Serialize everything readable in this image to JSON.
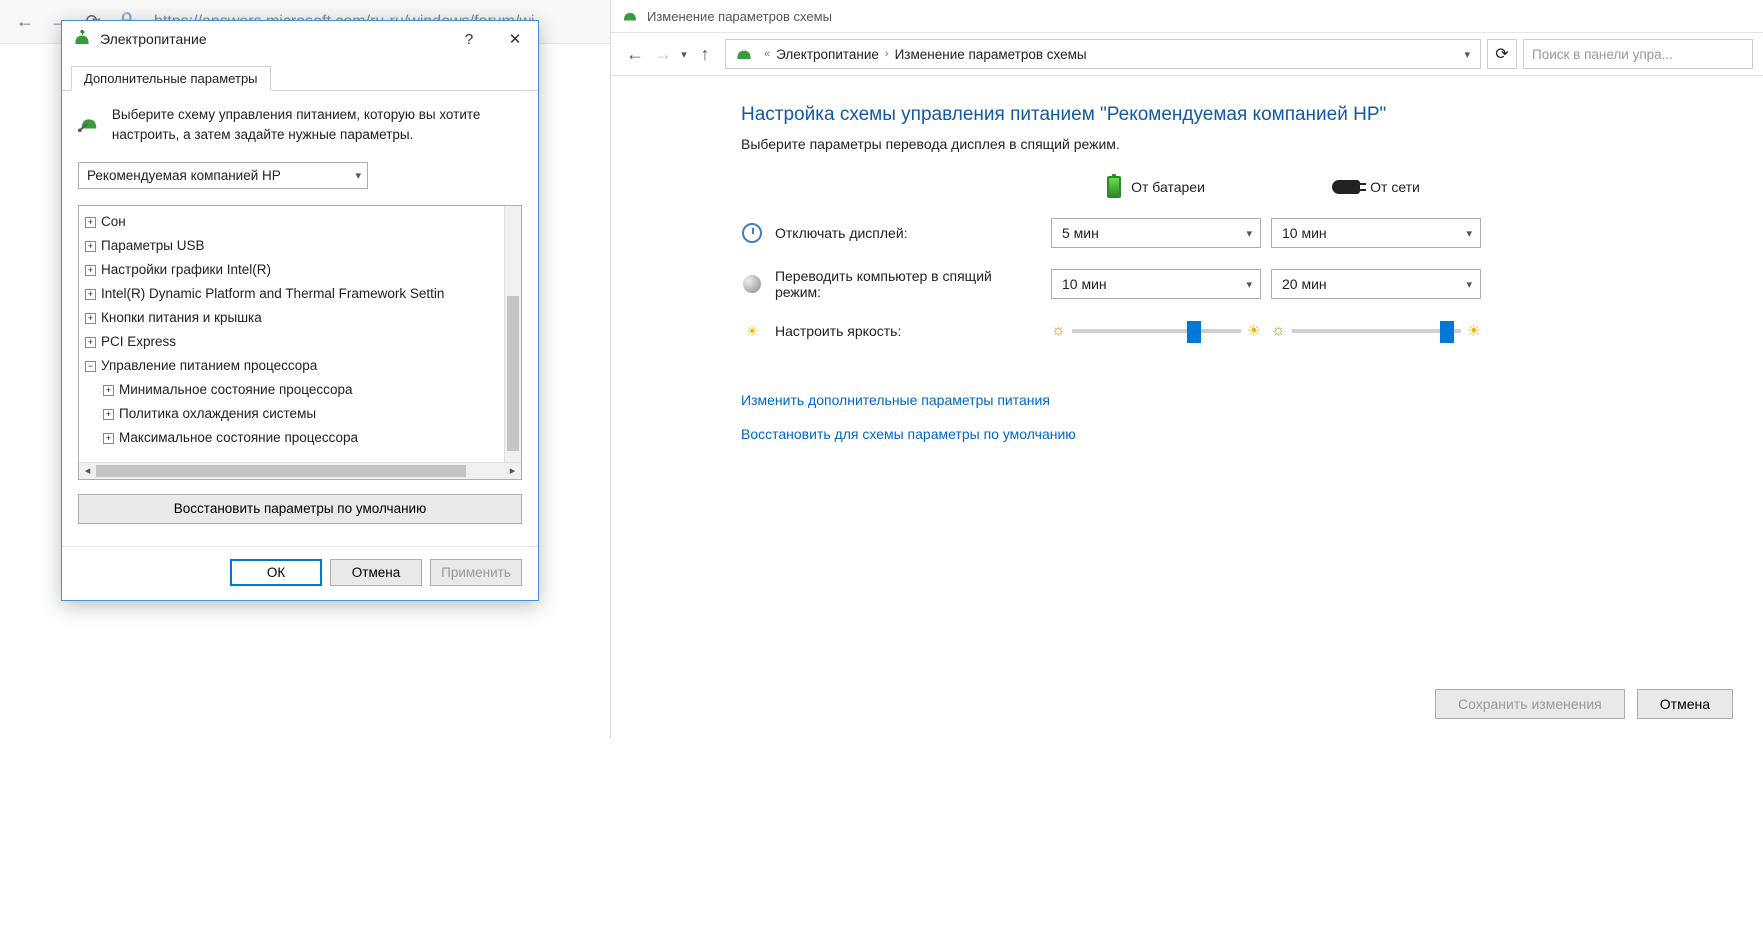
{
  "browser": {
    "url": "https://answers.microsoft.com/ru-ru/windows/forum/wi"
  },
  "dialog": {
    "title": "Электропитание",
    "tab": "Дополнительные параметры",
    "instruction": "Выберите схему управления питанием, которую вы хотите настроить, а затем задайте нужные параметры.",
    "combo": "Рекомендуемая компанией HP",
    "tree": [
      {
        "label": "Сон",
        "lvl": 0,
        "exp": "+"
      },
      {
        "label": "Параметры USB",
        "lvl": 0,
        "exp": "+"
      },
      {
        "label": "Настройки графики Intel(R)",
        "lvl": 0,
        "exp": "+"
      },
      {
        "label": "Intel(R) Dynamic Platform and Thermal Framework Settin",
        "lvl": 0,
        "exp": "+"
      },
      {
        "label": "Кнопки питания и крышка",
        "lvl": 0,
        "exp": "+"
      },
      {
        "label": "PCI Express",
        "lvl": 0,
        "exp": "+"
      },
      {
        "label": "Управление питанием процессора",
        "lvl": 0,
        "exp": "−"
      },
      {
        "label": "Минимальное состояние процессора",
        "lvl": 1,
        "exp": "+"
      },
      {
        "label": "Политика охлаждения системы",
        "lvl": 1,
        "exp": "+"
      },
      {
        "label": "Максимальное состояние процессора",
        "lvl": 1,
        "exp": "+"
      }
    ],
    "restore_btn": "Восстановить параметры по умолчанию",
    "ok": "ОК",
    "cancel": "Отмена",
    "apply": "Применить"
  },
  "panel": {
    "window_title": "Изменение параметров схемы",
    "crumb1": "Электропитание",
    "crumb2": "Изменение параметров схемы",
    "search_placeholder": "Поиск в панели упра...",
    "heading": "Настройка схемы управления питанием \"Рекомендуемая компанией HP\"",
    "sub": "Выберите параметры перевода дисплея в спящий режим.",
    "col_battery": "От батареи",
    "col_ac": "От сети",
    "row_display": "Отключать дисплей:",
    "row_sleep": "Переводить компьютер в спящий режим:",
    "row_bright": "Настроить яркость:",
    "display_batt": "5 мин",
    "display_ac": "10 мин",
    "sleep_batt": "10 мин",
    "sleep_ac": "20 мин",
    "link_adv": "Изменить дополнительные параметры питания",
    "link_restore": "Восстановить для схемы параметры по умолчанию",
    "save": "Сохранить изменения",
    "cancel": "Отмена"
  }
}
